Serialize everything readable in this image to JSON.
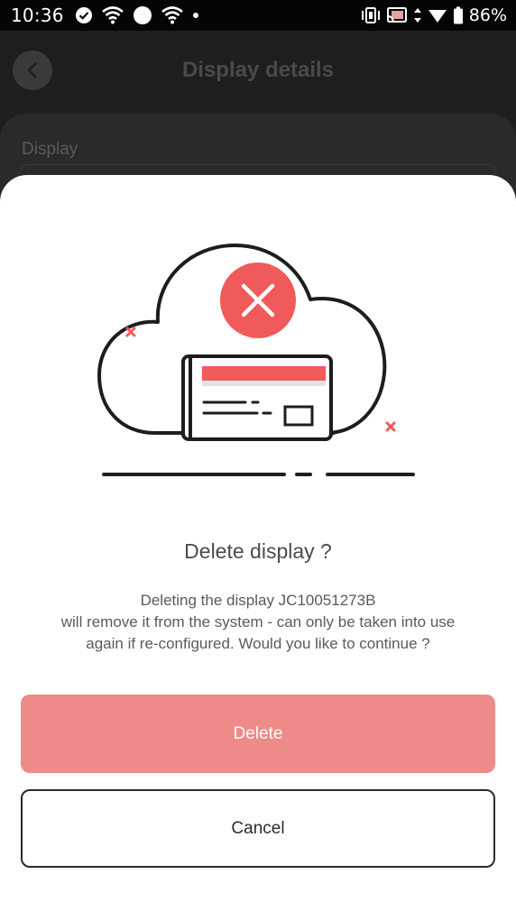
{
  "status_bar": {
    "time": "10:36",
    "battery": "86%"
  },
  "header": {
    "title": "Display details",
    "back_icon": "chevron-left-icon"
  },
  "background_card": {
    "label": "Display"
  },
  "dialog": {
    "title": "Delete display ?",
    "message_lines": [
      "Deleting the display JC10051273B",
      "will remove it from the system - can only be taken into use",
      "again if re-configured. Would you like to continue ?"
    ],
    "delete_label": "Delete",
    "cancel_label": "Cancel"
  },
  "colors": {
    "accent": "#f15a5a",
    "delete_button": "#ee8a88",
    "sheet_background": "#ffffff"
  }
}
